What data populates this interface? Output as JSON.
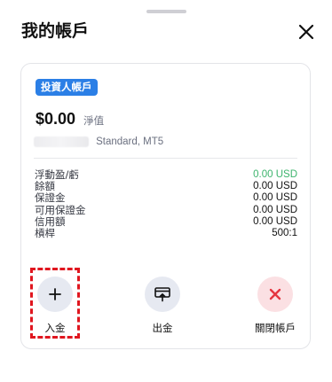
{
  "sheet": {
    "title": "我的帳戶",
    "close_icon": "close-icon"
  },
  "account": {
    "badge": "投資人帳戶",
    "balance": "$0.00",
    "balance_suffix": "淨值",
    "account_number_masked": true,
    "account_type": "Standard, MT5"
  },
  "stats": [
    {
      "label": "浮動盈/虧",
      "value": "0.00 USD",
      "status": "positive"
    },
    {
      "label": "餘額",
      "value": "0.00 USD",
      "status": "normal"
    },
    {
      "label": "保證金",
      "value": "0.00 USD",
      "status": "normal"
    },
    {
      "label": "可用保證金",
      "value": "0.00 USD",
      "status": "normal"
    },
    {
      "label": "信用額",
      "value": "0.00 USD",
      "status": "normal"
    },
    {
      "label": "槓桿",
      "value": "500:1",
      "status": "normal"
    }
  ],
  "actions": [
    {
      "label": "入金",
      "icon": "plus-icon",
      "highlighted": true
    },
    {
      "label": "出金",
      "icon": "withdraw-icon",
      "highlighted": false
    },
    {
      "label": "關閉帳戶",
      "icon": "close-account-icon",
      "highlighted": false
    }
  ],
  "colors": {
    "badge": "#2b7fe6",
    "positive": "#3db46d",
    "close_account": "#e5353f",
    "highlight": "#e0161f",
    "action_circle": "#e6e9f1",
    "close_circle": "#fbe0e3"
  }
}
